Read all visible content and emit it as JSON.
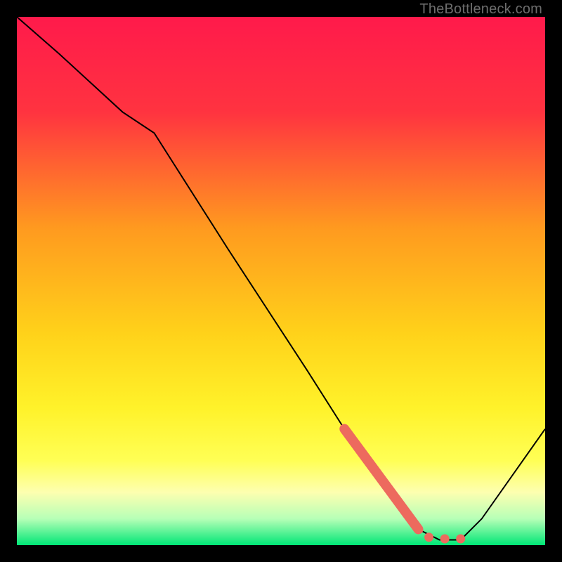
{
  "watermark": "TheBottleneck.com",
  "chart_data": {
    "type": "line",
    "title": "",
    "xlabel": "",
    "ylabel": "",
    "xlim": [
      0,
      100
    ],
    "ylim": [
      0,
      100
    ],
    "background_gradient": {
      "stops": [
        {
          "offset": 0,
          "color": "#ff1a4b"
        },
        {
          "offset": 18,
          "color": "#ff3340"
        },
        {
          "offset": 40,
          "color": "#ff9a1f"
        },
        {
          "offset": 60,
          "color": "#ffd21a"
        },
        {
          "offset": 74,
          "color": "#fff22a"
        },
        {
          "offset": 84,
          "color": "#ffff55"
        },
        {
          "offset": 90,
          "color": "#fdffb0"
        },
        {
          "offset": 95,
          "color": "#b7ffb7"
        },
        {
          "offset": 100,
          "color": "#00e676"
        }
      ]
    },
    "series": [
      {
        "name": "bottleneck-curve",
        "x": [
          0,
          8,
          20,
          26,
          40,
          55,
          62,
          70,
          76,
          80,
          84,
          88,
          100
        ],
        "y": [
          100,
          93,
          82,
          78,
          56,
          33,
          22,
          10,
          3,
          1,
          1,
          5,
          22
        ]
      }
    ],
    "highlight_segment": {
      "name": "optimal-range-marker",
      "color": "#ed6a5e",
      "thick": {
        "x": [
          62,
          76
        ],
        "y": [
          22,
          3
        ]
      },
      "dots": [
        {
          "x": 78,
          "y": 1.5
        },
        {
          "x": 81,
          "y": 1.2
        },
        {
          "x": 84,
          "y": 1.2
        }
      ]
    }
  }
}
